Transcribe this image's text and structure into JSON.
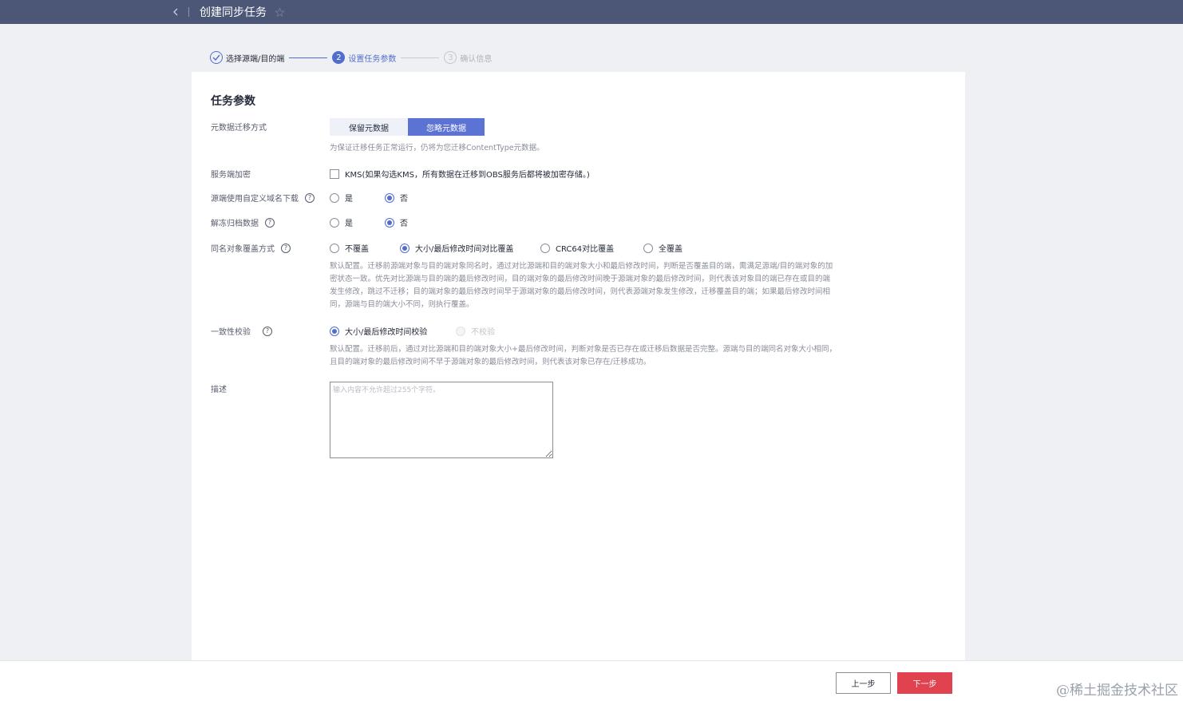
{
  "header": {
    "back_icon": "chevron-left-icon",
    "title": "创建同步任务",
    "favorite_icon": "star-outline-icon"
  },
  "steps": [
    {
      "index": "1",
      "label": "选择源端/目的端",
      "state": "done"
    },
    {
      "index": "2",
      "label": "设置任务参数",
      "state": "active"
    },
    {
      "index": "3",
      "label": "确认信息",
      "state": "todo"
    }
  ],
  "form": {
    "section_title": "任务参数",
    "metadata": {
      "label": "元数据迁移方式",
      "options": [
        "保留元数据",
        "忽略元数据"
      ],
      "selected": "忽略元数据",
      "hint": "为保证迁移任务正常运行，仍将为您迁移ContentType元数据。"
    },
    "encryption": {
      "label": "服务端加密",
      "checkbox_text": "KMS(如果勾选KMS，所有数据在迁移到OBS服务后都将被加密存储。)",
      "checked": false
    },
    "custom_domain": {
      "label": "源端使用自定义域名下载",
      "options": [
        "是",
        "否"
      ],
      "selected": "否"
    },
    "unfreeze": {
      "label": "解冻归档数据",
      "options": [
        "是",
        "否"
      ],
      "selected": "否"
    },
    "overwrite": {
      "label": "同名对象覆盖方式",
      "options": [
        "不覆盖",
        "大小/最后修改时间对比覆盖",
        "CRC64对比覆盖",
        "全覆盖"
      ],
      "selected": "大小/最后修改时间对比覆盖",
      "hint_lines": [
        "默认配置。迁移前源端对象与目的端对象同名时，通过对比源端和目的端对象大小和最后修改时间，判断是否覆盖目的端，需满足源端/目的端对象的加",
        "密状态一致。优先对比源端与目的端的最后修改时间，目的端对象的最后修改时间晚于源端对象的最后修改时间，则代表该对象目的端已存在或目的端",
        "发生修改，跳过不迁移；目的端对象的最后修改时间早于源端对象的最后修改时间，则代表源端对象发生修改，迁移覆盖目的端；如果最后修改时间相",
        "同，源端与目的端大小不同，则执行覆盖。"
      ]
    },
    "consistency": {
      "label": "一致性校验",
      "options": [
        "大小/最后修改时间校验",
        "不校验"
      ],
      "selected": "大小/最后修改时间校验",
      "hint_lines": [
        "默认配置。迁移前后，通过对比源端和目的端对象大小+最后修改时间，判断对象是否已存在或迁移后数据是否完整。源端与目的端同名对象大小相同，",
        "且目的端对象的最后修改时间不早于源端对象的最后修改时间，则代表该对象已存在/迁移成功。"
      ]
    },
    "description": {
      "label": "描述",
      "placeholder": "输入内容不允许超过255个字符。",
      "value": ""
    }
  },
  "footer": {
    "prev_label": "上一步",
    "next_label": "下一步",
    "watermark": "@稀土掘金技术社区"
  },
  "colors": {
    "topbar": "#4c5778",
    "primary": "#526ecc",
    "danger": "#e0424f"
  }
}
